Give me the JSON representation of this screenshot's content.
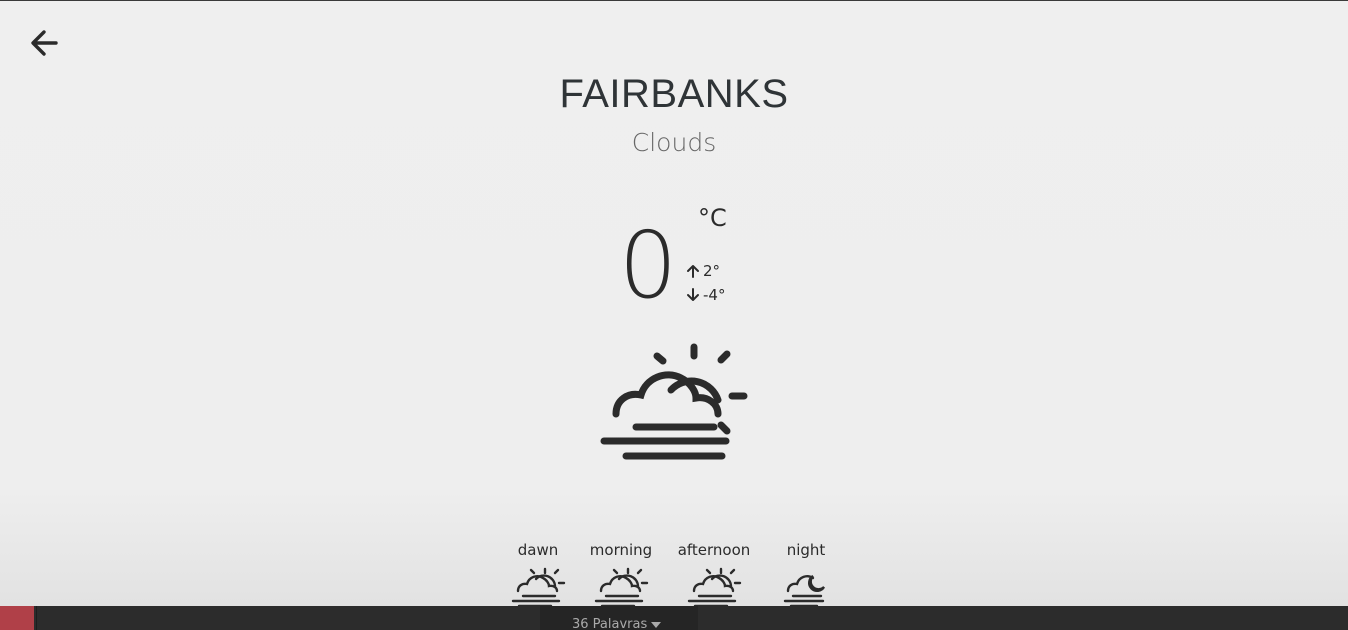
{
  "header": {
    "back_icon": "arrow-left-icon"
  },
  "weather": {
    "city": "FAIRBANKS",
    "condition": "Clouds",
    "temperature": "0",
    "unit": "°C",
    "high": "2°",
    "low": "-4°",
    "icon": "partly-cloudy-fog-icon"
  },
  "forecast": [
    {
      "label": "dawn",
      "icon": "sun-cloud-fog-icon"
    },
    {
      "label": "morning",
      "icon": "sun-cloud-fog-icon"
    },
    {
      "label": "afternoon",
      "icon": "sun-cloud-fog-icon"
    },
    {
      "label": "night",
      "icon": "moon-cloud-fog-icon"
    }
  ],
  "taskbar": {
    "word_count": "36 Palavras",
    "accent": "#b04048"
  },
  "colors": {
    "background": "#eeeeee",
    "text": "#2b2b2b",
    "taskbar": "#2c2c2c"
  }
}
